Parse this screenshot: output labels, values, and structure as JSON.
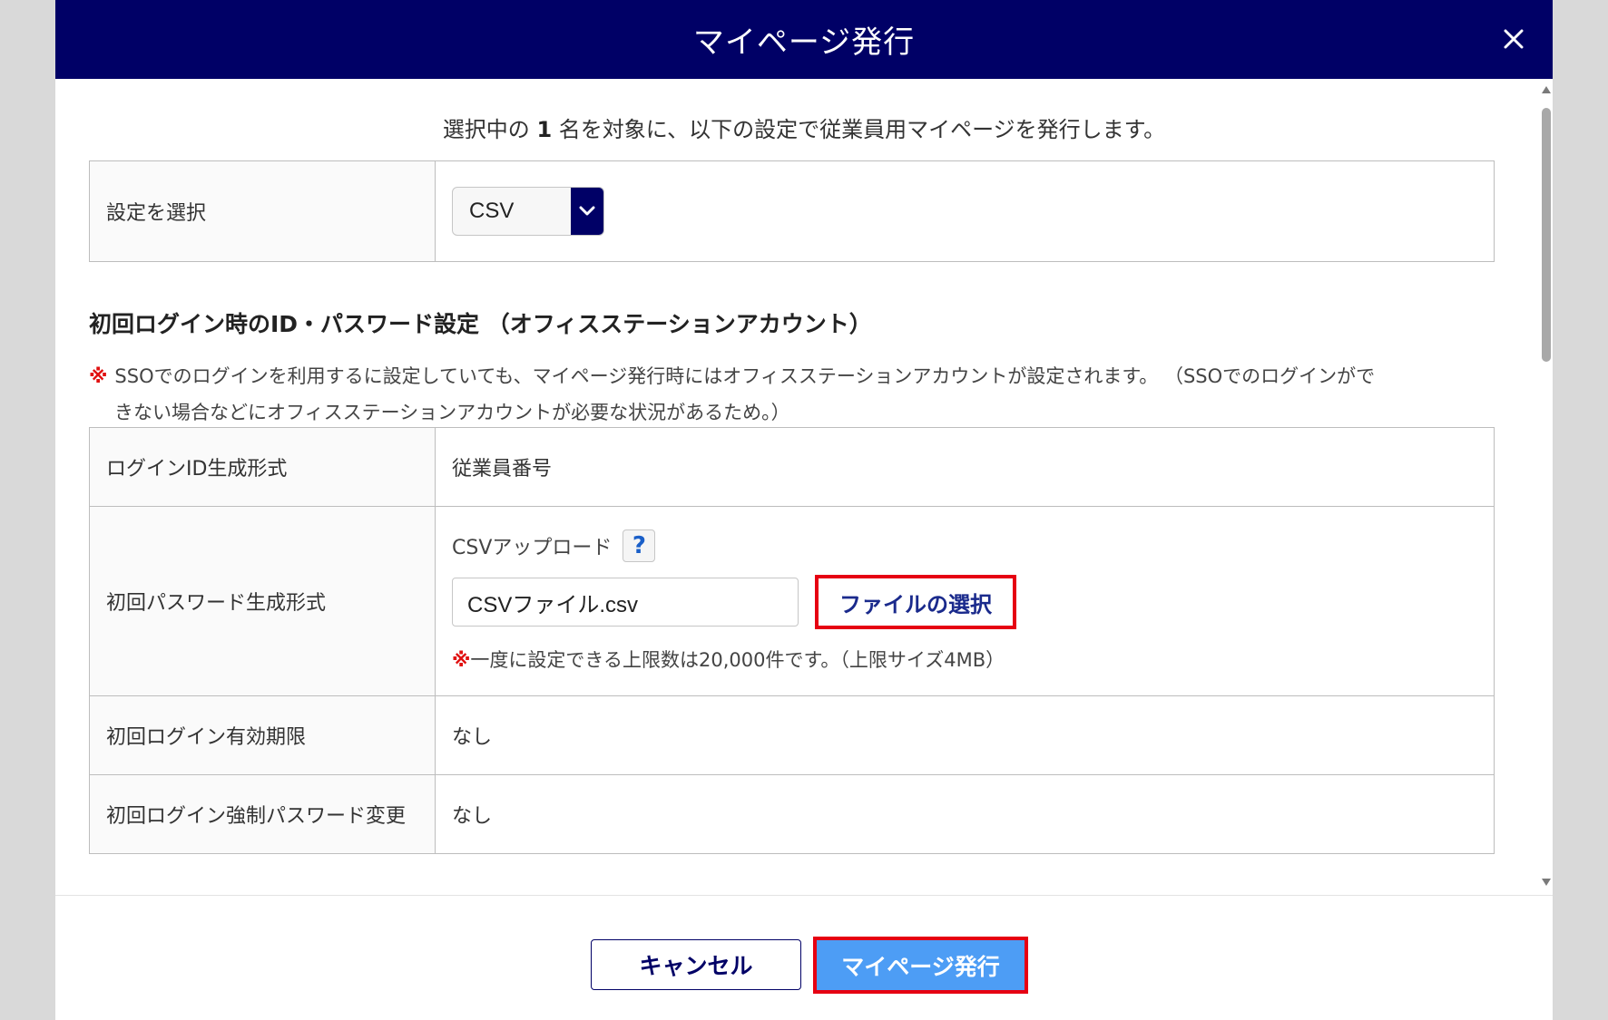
{
  "header": {
    "title": "マイページ発行",
    "close_icon": "close-icon"
  },
  "intro": {
    "prefix": "選択中の ",
    "count": "1",
    "suffix": " 名を対象に、以下の設定で従業員用マイページを発行します。"
  },
  "settings": {
    "label": "設定を選択",
    "selected_value": "CSV"
  },
  "section": {
    "title": "初回ログイン時のID・パスワード設定 （オフィスステーションアカウント）",
    "note_mark": "※",
    "note_line1": "SSOでのログインを利用するに設定していても、マイページ発行時にはオフィスステーションアカウントが設定されます。 （SSOでのログインがで",
    "note_line2": "きない場合などにオフィスステーションアカウントが必要な状況があるため。）"
  },
  "rows": {
    "login_id": {
      "label": "ログインID生成形式",
      "value": "従業員番号"
    },
    "password": {
      "label": "初回パスワード生成形式",
      "upload_label": "CSVアップロード",
      "help_glyph": "?",
      "file_name": "CSVファイル.csv",
      "file_select_label": "ファイルの選択",
      "limit_mark": "※",
      "limit_note": "一度に設定できる上限数は20,000件です。（上限サイズ4MB）"
    },
    "expiry": {
      "label": "初回ログイン有効期限",
      "value": "なし"
    },
    "force_change": {
      "label": "初回ログイン強制パスワード変更",
      "value": "なし"
    }
  },
  "footer": {
    "cancel_label": "キャンセル",
    "publish_label": "マイページ発行"
  },
  "colors": {
    "header_bg": "#000066",
    "primary_button": "#4d9df5",
    "highlight_border": "#e60012",
    "note_mark": "#e01010"
  }
}
